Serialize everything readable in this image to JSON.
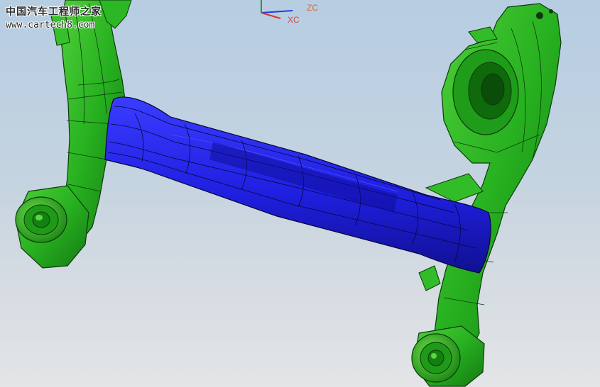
{
  "watermark": {
    "title": "中国汽车工程师之家",
    "url": "www.cartech8.com"
  },
  "triad": {
    "z_label": "ZC",
    "x_label": "XC",
    "colors": {
      "x": "#e03030",
      "y": "#20a020",
      "z": "#2040e0"
    }
  },
  "model": {
    "frame_color": "#27b020",
    "frame_edge_color": "#0d3a0a",
    "crossmember_color": "#2020e8",
    "crossmember_edge_color": "#06063a"
  },
  "viewport": {
    "background_top": "#b6cde2",
    "background_bottom": "#e3e5e7"
  }
}
